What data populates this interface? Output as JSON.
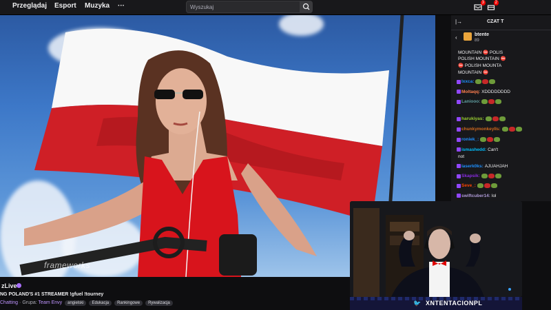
{
  "nav": {
    "browse": "Przeglądaj",
    "esport": "Esport",
    "music": "Muzyka",
    "more": "···"
  },
  "search": {
    "placeholder": "Wyszukaj"
  },
  "notifications": {
    "inbox_count": "3",
    "prime_count": "2"
  },
  "video": {
    "watermark": "frameworks"
  },
  "stream": {
    "channel": "zLive",
    "title": "NG POLAND'S #1 STREAMER !gfuel !tourney",
    "category_prefix": "Chatting",
    "group_label": "Grupa:",
    "team": "Team Envy",
    "tags": [
      "angielski",
      "Edukacja",
      "Rankingowe",
      "Rywalizacja"
    ]
  },
  "chat": {
    "header": "CZAT T",
    "gift_user": "btente",
    "gift_count": "89",
    "messages": [
      {
        "user": "",
        "text": "MOUNTAIN ⛔ POLIS"
      },
      {
        "user": "",
        "text": "POLISH MOUNTAIN ⛔"
      },
      {
        "user": "",
        "text": "⛔ POLISH MOUNTA"
      },
      {
        "user": "",
        "text": "MOUNTAIN ⛔"
      },
      {
        "user": "lxxca:",
        "text": "",
        "color": "#1e90ff"
      },
      {
        "user": "Moltaqq:",
        "text": "XDDDDDDDD",
        "color": "#ff7f50"
      },
      {
        "user": "Laniooo:",
        "text": "",
        "color": "#5f9ea0"
      },
      {
        "user": "",
        "text": ""
      },
      {
        "user": "harukiyas:",
        "text": "",
        "color": "#9acd32"
      },
      {
        "user": "chunkymonkeyIIs:",
        "text": "",
        "color": "#d2691e"
      },
      {
        "user": "roniek_:",
        "text": "",
        "color": "#1e90ff"
      },
      {
        "user": "ismashedd:",
        "text": "Can't",
        "color": "#00bfff"
      },
      {
        "user": "",
        "text": "not"
      },
      {
        "user": "laserk0ks:",
        "text": "AJUAHJAH",
        "color": "#1e90ff"
      },
      {
        "user": "Skapsik:",
        "text": "",
        "color": "#8a2be2"
      },
      {
        "user": "Seve_:",
        "text": "",
        "color": "#ff4500"
      },
      {
        "user": "swiftcuber14:",
        "text": "lol",
        "color": "#b19cd9"
      }
    ]
  },
  "webcam": {
    "handle": "XNTENTACIONPL"
  },
  "colors": {
    "accent": "#9147ff",
    "flag_white": "#f4f4f4",
    "flag_red": "#d01e22",
    "dress": "#d8141c"
  }
}
